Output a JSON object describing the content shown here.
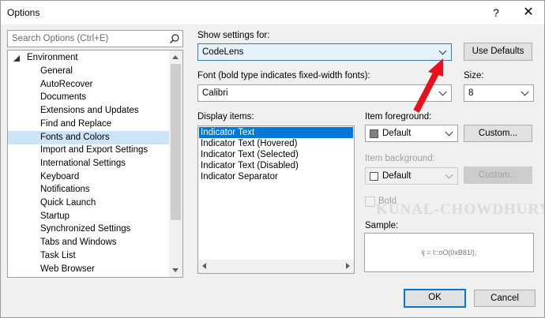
{
  "window": {
    "title": "Options",
    "help_glyph": "?",
    "close_glyph": "✕"
  },
  "search": {
    "placeholder": "Search Options (Ctrl+E)"
  },
  "tree": {
    "root": "Environment",
    "items": [
      "General",
      "AutoRecover",
      "Documents",
      "Extensions and Updates",
      "Find and Replace",
      "Fonts and Colors",
      "Import and Export Settings",
      "International Settings",
      "Keyboard",
      "Notifications",
      "Quick Launch",
      "Startup",
      "Synchronized Settings",
      "Tabs and Windows",
      "Task List",
      "Web Browser"
    ],
    "selected": "Fonts and Colors"
  },
  "settings": {
    "show_label": "Show settings for:",
    "show_value": "CodeLens",
    "use_defaults": "Use Defaults",
    "font_label": "Font (bold type indicates fixed-width fonts):",
    "font_value": "Calibri",
    "size_label": "Size:",
    "size_value": "8"
  },
  "display": {
    "label": "Display items:",
    "items": [
      "Indicator Text",
      "Indicator Text (Hovered)",
      "Indicator Text (Selected)",
      "Indicator Text (Disabled)",
      "Indicator Separator"
    ],
    "selected": "Indicator Text"
  },
  "foreground": {
    "label": "Item foreground:",
    "value": "Default",
    "custom": "Custom...",
    "swatch_color": "#808080"
  },
  "background": {
    "label": "Item background:",
    "value": "Default",
    "custom": "Custom...",
    "swatch_color": "#ffffff"
  },
  "bold_label": "Bold",
  "sample": {
    "label": "Sample:",
    "text": "ij = I::oO(0xB81l);"
  },
  "footer": {
    "ok": "OK",
    "cancel": "Cancel"
  },
  "watermark": "KUNAL-CHOWDHURY",
  "colors": {
    "accent": "#0078d7",
    "arrow": "#e8101a",
    "selection_light": "#cce4f7"
  }
}
